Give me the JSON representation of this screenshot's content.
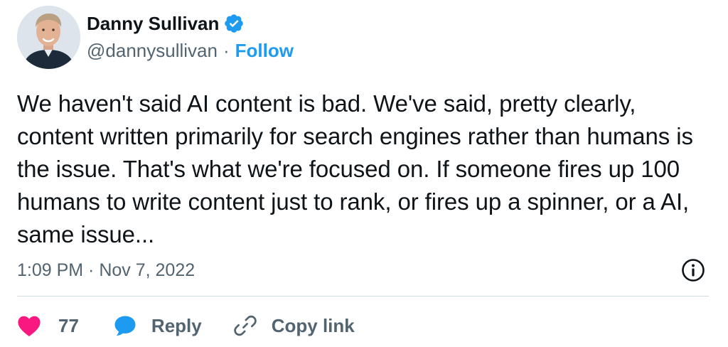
{
  "author": {
    "name": "Danny Sullivan",
    "handle": "@dannysullivan",
    "separator": "·",
    "follow_label": "Follow",
    "verified_icon": "verified-badge-icon"
  },
  "tweet": {
    "text": "We haven't said AI content is bad. We've said, pretty clearly, content written primarily for search engines rather than humans is the issue. That's what we're focused on. If someone fires up 100 humans to write content just to rank, or fires up a spinner, or a AI, same issue...",
    "timestamp": "1:09 PM · Nov 7, 2022"
  },
  "actions": {
    "like_count": "77",
    "reply_label": "Reply",
    "copy_link_label": "Copy link"
  },
  "colors": {
    "accent": "#1d9bf0",
    "like": "#f91880",
    "text_primary": "#0f1419",
    "text_secondary": "#536471",
    "divider": "#cfd9de"
  }
}
